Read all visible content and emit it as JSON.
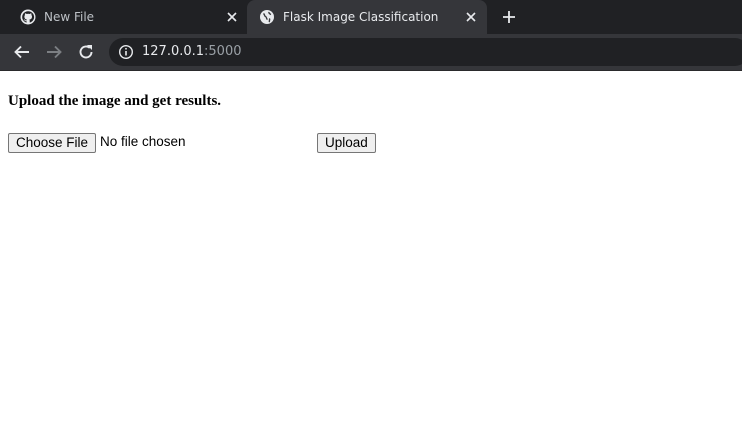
{
  "browser": {
    "tabs": [
      {
        "title": "New File",
        "favicon": "github-icon",
        "active": false
      },
      {
        "title": "Flask Image Classification",
        "favicon": "globe-icon",
        "active": true
      }
    ],
    "address": {
      "host": "127.0.0.1",
      "port": ":5000"
    }
  },
  "page": {
    "heading": "Upload the image and get results.",
    "file_input": {
      "button_label": "Choose File",
      "status": "No file chosen"
    },
    "upload_button": "Upload"
  },
  "colors": {
    "tabstrip": "#202124",
    "toolbar": "#35363a",
    "omnibox": "#202124",
    "page_bg": "#ffffff"
  }
}
